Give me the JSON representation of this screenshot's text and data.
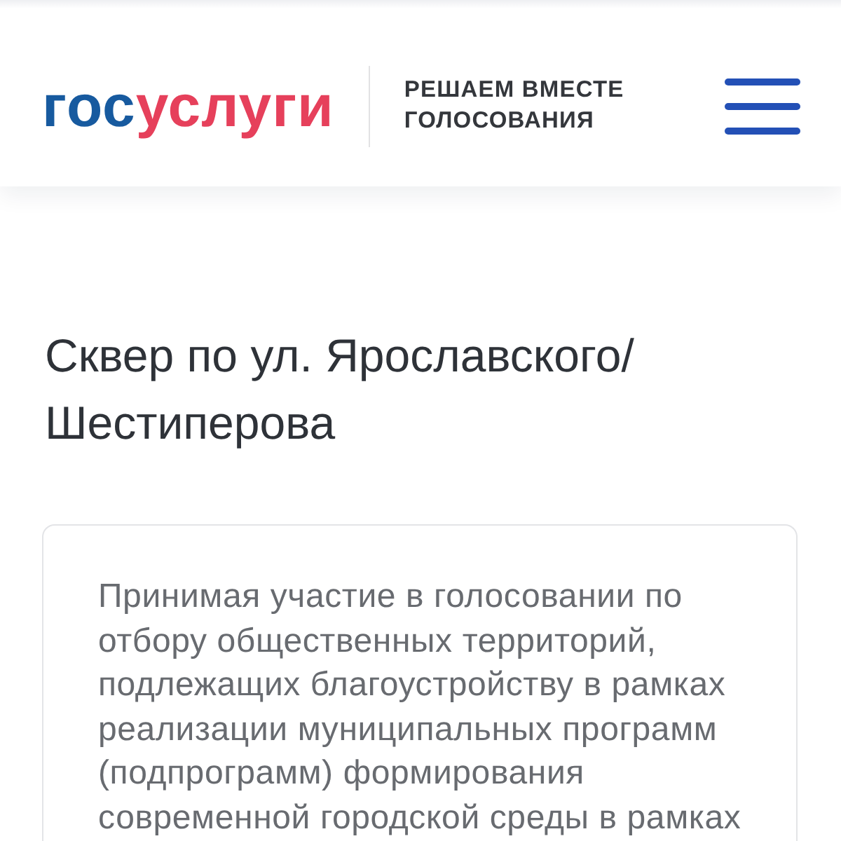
{
  "header": {
    "logo": {
      "first_part": "гос",
      "second_part": "услуги"
    },
    "tagline": [
      "РЕШАЕМ ВМЕСТЕ",
      "ГОЛОСОВАНИЯ"
    ]
  },
  "page": {
    "title": "Сквер по ул. Ярославского/Шестиперова"
  },
  "card": {
    "text": "Принимая участие в голосовании по отбору общественных территорий, подлежащих благоустройству в рамках реализации муниципальных программ (подпрограмм) формирования современной городской среды в рамках"
  }
}
